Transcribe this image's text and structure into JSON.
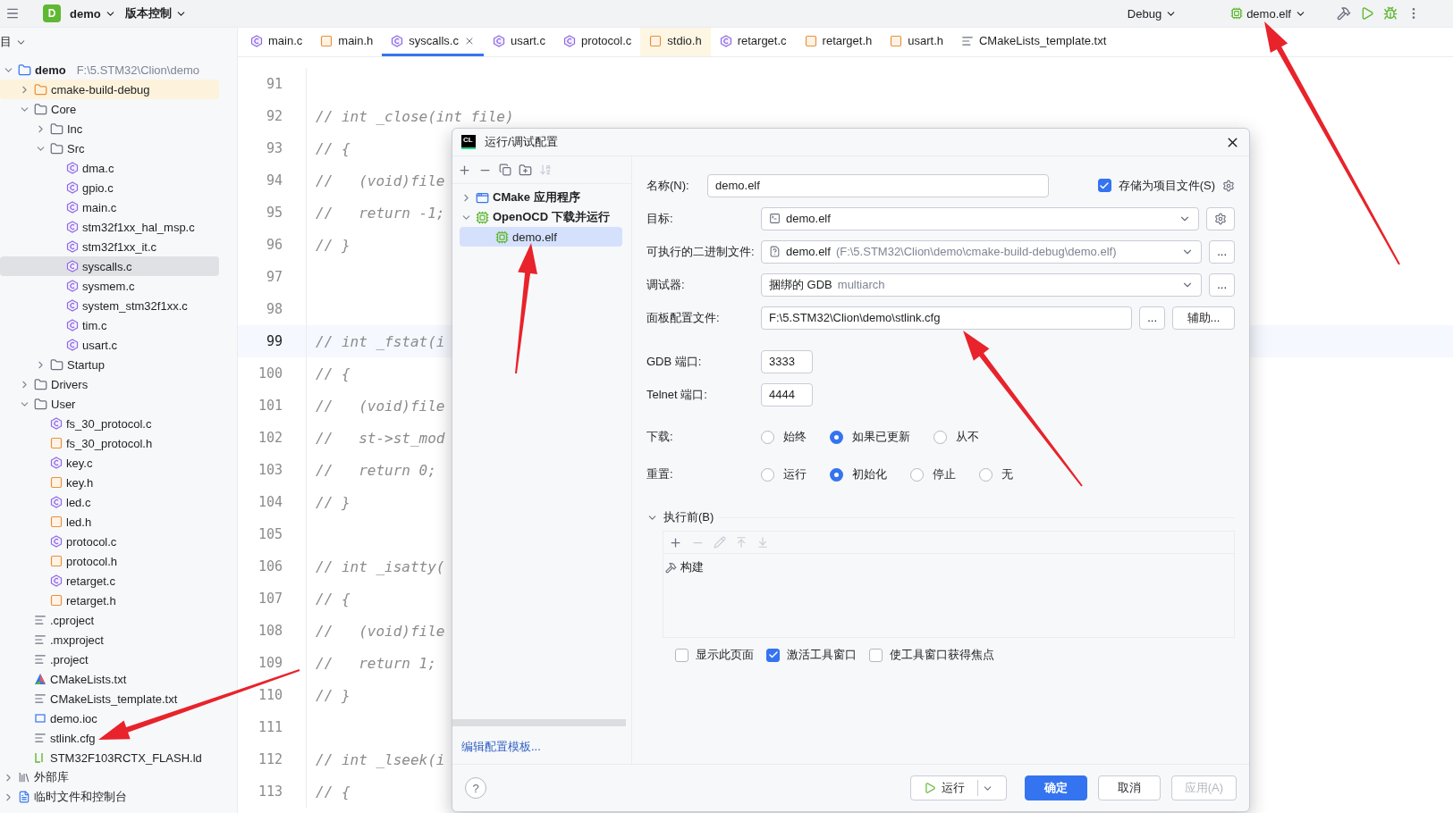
{
  "top_bar": {
    "project_badge": "D",
    "project": "demo",
    "vcs": "版本控制",
    "build_config": "Debug",
    "run_config": "demo.elf"
  },
  "project_panel": {
    "title": "目",
    "tree": [
      {
        "label": "demo",
        "hint": "F:\\5.STM32\\Clion\\demo",
        "kind": "module",
        "expanded": true,
        "selected": false,
        "children": [
          {
            "label": "cmake-build-debug",
            "kind": "build-folder",
            "expanded": false,
            "selected": false
          },
          {
            "label": "Core",
            "kind": "folder",
            "expanded": true,
            "selected": false,
            "children": [
              {
                "label": "Inc",
                "kind": "folder",
                "expanded": false,
                "selected": false
              },
              {
                "label": "Src",
                "kind": "folder",
                "expanded": true,
                "selected": false,
                "children": [
                  {
                    "label": "dma.c",
                    "kind": "c",
                    "selected": false
                  },
                  {
                    "label": "gpio.c",
                    "kind": "c",
                    "selected": false
                  },
                  {
                    "label": "main.c",
                    "kind": "c",
                    "selected": false
                  },
                  {
                    "label": "stm32f1xx_hal_msp.c",
                    "kind": "c",
                    "selected": false
                  },
                  {
                    "label": "stm32f1xx_it.c",
                    "kind": "c",
                    "selected": false
                  },
                  {
                    "label": "syscalls.c",
                    "kind": "c",
                    "selected": true
                  },
                  {
                    "label": "sysmem.c",
                    "kind": "c",
                    "selected": false
                  },
                  {
                    "label": "system_stm32f1xx.c",
                    "kind": "c",
                    "selected": false
                  },
                  {
                    "label": "tim.c",
                    "kind": "c",
                    "selected": false
                  },
                  {
                    "label": "usart.c",
                    "kind": "c",
                    "selected": false
                  }
                ]
              },
              {
                "label": "Startup",
                "kind": "folder",
                "expanded": false,
                "selected": false
              }
            ]
          },
          {
            "label": "Drivers",
            "kind": "folder",
            "expanded": false,
            "selected": false
          },
          {
            "label": "User",
            "kind": "folder",
            "expanded": true,
            "selected": false,
            "children": [
              {
                "label": "fs_30_protocol.c",
                "kind": "c",
                "selected": false
              },
              {
                "label": "fs_30_protocol.h",
                "kind": "h",
                "selected": false
              },
              {
                "label": "key.c",
                "kind": "c",
                "selected": false
              },
              {
                "label": "key.h",
                "kind": "h",
                "selected": false
              },
              {
                "label": "led.c",
                "kind": "c",
                "selected": false
              },
              {
                "label": "led.h",
                "kind": "h",
                "selected": false
              },
              {
                "label": "protocol.c",
                "kind": "c",
                "selected": false
              },
              {
                "label": "protocol.h",
                "kind": "h",
                "selected": false
              },
              {
                "label": "retarget.c",
                "kind": "c",
                "selected": false
              },
              {
                "label": "retarget.h",
                "kind": "h",
                "selected": false
              }
            ]
          },
          {
            "label": ".cproject",
            "kind": "text",
            "selected": false
          },
          {
            "label": ".mxproject",
            "kind": "text",
            "selected": false
          },
          {
            "label": ".project",
            "kind": "text",
            "selected": false
          },
          {
            "label": "CMakeLists.txt",
            "kind": "cmake",
            "selected": false
          },
          {
            "label": "CMakeLists_template.txt",
            "kind": "text",
            "selected": false
          },
          {
            "label": "demo.ioc",
            "kind": "ioc",
            "selected": false
          },
          {
            "label": "stlink.cfg",
            "kind": "text",
            "selected": false
          },
          {
            "label": "STM32F103RCTX_FLASH.ld",
            "kind": "ld",
            "selected": false
          }
        ]
      },
      {
        "label": "外部库",
        "kind": "library",
        "expanded": false,
        "selected": false
      },
      {
        "label": "临时文件和控制台",
        "kind": "scratch",
        "expanded": false,
        "selected": false
      }
    ]
  },
  "editor_tabs": [
    {
      "label": "main.c",
      "kind": "c",
      "selected": false
    },
    {
      "label": "main.h",
      "kind": "h",
      "selected": false
    },
    {
      "label": "syscalls.c",
      "kind": "c",
      "selected": true
    },
    {
      "label": "usart.c",
      "kind": "c",
      "selected": false
    },
    {
      "label": "protocol.c",
      "kind": "c",
      "selected": false
    },
    {
      "label": "stdio.h",
      "kind": "h",
      "selected": false,
      "external": true
    },
    {
      "label": "retarget.c",
      "kind": "c",
      "selected": false
    },
    {
      "label": "retarget.h",
      "kind": "h",
      "selected": false
    },
    {
      "label": "usart.h",
      "kind": "h",
      "selected": false
    },
    {
      "label": "CMakeLists_template.txt",
      "kind": "text",
      "selected": false
    }
  ],
  "editor": {
    "lines": [
      {
        "number": "91",
        "current": false
      },
      {
        "number": "92",
        "code": "// int _close(int file)",
        "current": false
      },
      {
        "number": "93",
        "code": "// {",
        "current": false
      },
      {
        "number": "94",
        "code": "//   (void)file",
        "current": false
      },
      {
        "number": "95",
        "code": "//   return -1;",
        "current": false
      },
      {
        "number": "96",
        "code": "// }",
        "current": false
      },
      {
        "number": "97",
        "current": false
      },
      {
        "number": "98",
        "current": false
      },
      {
        "number": "99",
        "code": "// int _fstat(i",
        "current": true
      },
      {
        "number": "100",
        "code": "// {",
        "current": false
      },
      {
        "number": "101",
        "code": "//   (void)file",
        "current": false
      },
      {
        "number": "102",
        "code": "//   st->st_mod",
        "current": false
      },
      {
        "number": "103",
        "code": "//   return 0;",
        "current": false
      },
      {
        "number": "104",
        "code": "// }",
        "current": false
      },
      {
        "number": "105",
        "current": false
      },
      {
        "number": "106",
        "code": "// int _isatty(",
        "current": false
      },
      {
        "number": "107",
        "code": "// {",
        "current": false
      },
      {
        "number": "108",
        "code": "//   (void)file",
        "current": false
      },
      {
        "number": "109",
        "code": "//   return 1;",
        "current": false
      },
      {
        "number": "110",
        "code": "// }",
        "current": false
      },
      {
        "number": "111",
        "current": false
      },
      {
        "number": "112",
        "code": "// int _lseek(i",
        "current": false
      },
      {
        "number": "113",
        "code": "// {",
        "current": false
      }
    ]
  },
  "dialog": {
    "logo": "CL",
    "title": "运行/调试配置",
    "config_tree": [
      {
        "label": "CMake 应用程序",
        "kind": "cmake-app",
        "expanded": false,
        "selected": false
      },
      {
        "label": "OpenOCD 下载并运行",
        "kind": "openocd",
        "expanded": true,
        "selected": false,
        "children": [
          {
            "label": "demo.elf",
            "kind": "config",
            "selected": true
          }
        ]
      }
    ],
    "edit_templates_link": "编辑配置模板...",
    "help": "?",
    "name": {
      "label": "名称(N):",
      "value": "demo.elf"
    },
    "store_as_file": {
      "label": "存储为项目文件(S)",
      "checked": true
    },
    "target": {
      "label": "目标:",
      "value": "demo.elf"
    },
    "executable": {
      "label": "可执行的二进制文件:",
      "value": "demo.elf",
      "hint": "(F:\\5.STM32\\Clion\\demo\\cmake-build-debug\\demo.elf)",
      "browse": "..."
    },
    "debugger": {
      "label": "调试器:",
      "value": "捆绑的 GDB",
      "hint": "multiarch",
      "browse": "..."
    },
    "board_config": {
      "label": "面板配置文件:",
      "value": "F:\\5.STM32\\Clion\\demo\\stlink.cfg",
      "browse": "...",
      "assist": "辅助..."
    },
    "gdb_port": {
      "label": "GDB 端口:",
      "value": "3333"
    },
    "telnet_port": {
      "label": "Telnet 端口:",
      "value": "4444"
    },
    "radio_groups": [
      {
        "label": "下载:",
        "options": [
          {
            "label": "始终",
            "selected": false
          },
          {
            "label": "如果已更新",
            "selected": true
          },
          {
            "label": "从不",
            "selected": false
          }
        ]
      },
      {
        "label": "重置:",
        "options": [
          {
            "label": "运行",
            "selected": false
          },
          {
            "label": "初始化",
            "selected": true
          },
          {
            "label": "停止",
            "selected": false
          },
          {
            "label": "无",
            "selected": false
          }
        ]
      }
    ],
    "before_launch": {
      "title": "执行前(B)",
      "expanded": true,
      "tools": [
        {
          "kind": "add",
          "disabled": false
        },
        {
          "kind": "remove",
          "disabled": true
        },
        {
          "kind": "edit",
          "disabled": true
        },
        {
          "kind": "up",
          "disabled": true
        },
        {
          "kind": "down",
          "disabled": true
        }
      ],
      "tasks": [
        {
          "label": "构建"
        }
      ]
    },
    "options": [
      {
        "label": "显示此页面",
        "checked": false
      },
      {
        "label": "激活工具窗口",
        "checked": true
      },
      {
        "label": "使工具窗口获得焦点",
        "checked": false
      }
    ],
    "buttons": [
      {
        "label": "运行",
        "kind": "run",
        "disabled": false
      },
      {
        "label": "确定",
        "kind": "primary",
        "disabled": false
      },
      {
        "label": "取消",
        "kind": "normal",
        "disabled": false
      },
      {
        "label": "应用(A)",
        "kind": "normal",
        "disabled": true
      }
    ]
  }
}
